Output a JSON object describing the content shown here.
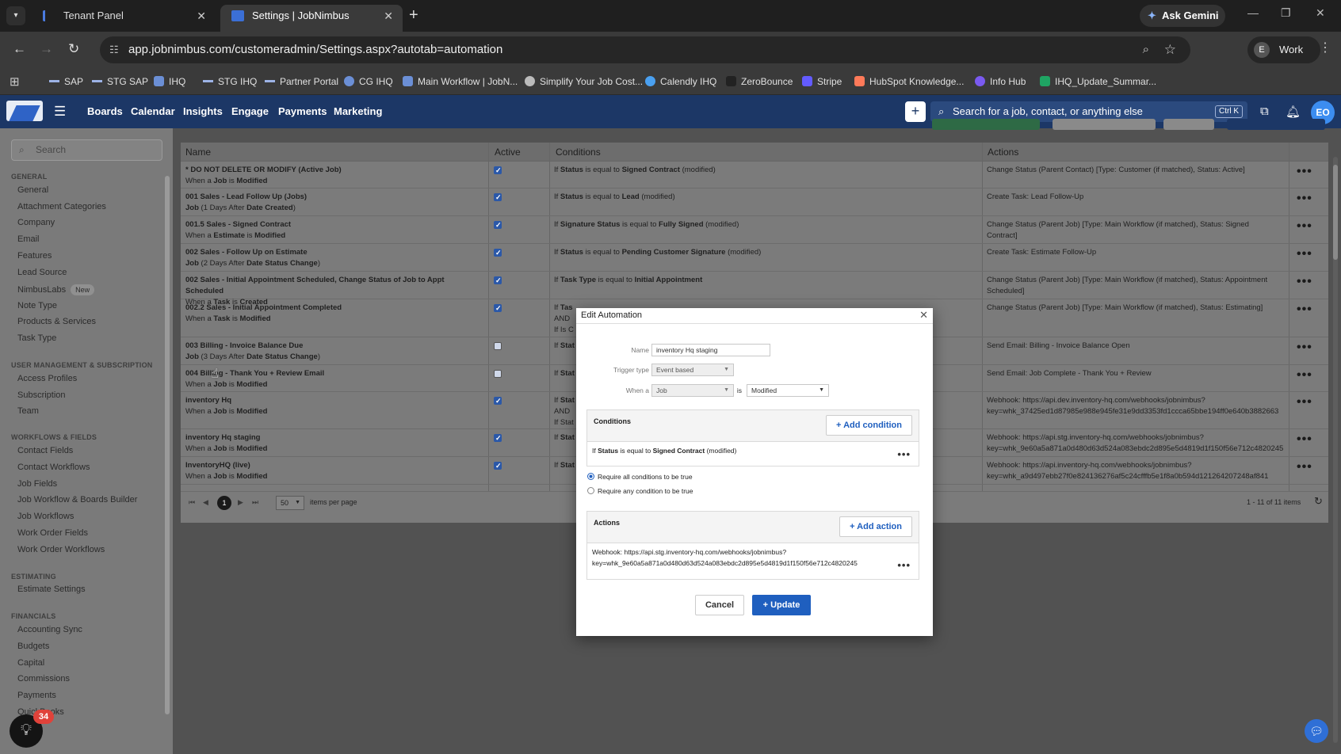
{
  "browser": {
    "tabs": [
      {
        "title": "Tenant Panel"
      },
      {
        "title": "Settings | JobNimbus"
      }
    ],
    "ask_gemini": "Ask Gemini",
    "url": "app.jobnimbus.com/customeradmin/Settings.aspx?autotab=automation",
    "profile_initial": "E",
    "profile_name": "Work",
    "bookmarks": [
      "SAP",
      "STG SAP",
      "IHQ",
      "STG IHQ",
      "Partner Portal",
      "CG IHQ",
      "Main Workflow | JobN...",
      "Simplify Your Job Cost...",
      "Calendly IHQ",
      "ZeroBounce",
      "Stripe",
      "HubSpot Knowledge...",
      "Info Hub",
      "IHQ_Update_Summar..."
    ]
  },
  "app_header": {
    "nav": [
      "Boards",
      "Calendar",
      "Insights",
      "Engage",
      "Payments",
      "Marketing"
    ],
    "search_placeholder": "Search for a job, contact, or anything else",
    "shortcut": "Ctrl K",
    "avatar": "EO"
  },
  "sidebar": {
    "search_placeholder": "Search",
    "general_head": "GENERAL",
    "general": [
      "General",
      "Attachment Categories",
      "Company",
      "Email",
      "Features",
      "Lead Source",
      "NimbusLabs",
      "Note Type",
      "Products & Services",
      "Task Type"
    ],
    "new_badge": "New",
    "user_head": "USER MANAGEMENT & SUBSCRIPTION",
    "user": [
      "Access Profiles",
      "Subscription",
      "Team"
    ],
    "workflows_head": "WORKFLOWS & FIELDS",
    "workflows": [
      "Contact Fields",
      "Contact Workflows",
      "Job Fields",
      "Job Workflow & Boards Builder",
      "Job Workflows",
      "Work Order Fields",
      "Work Order Workflows"
    ],
    "estimating_head": "ESTIMATING",
    "estimating": [
      "Estimate Settings"
    ],
    "financials_head": "FINANCIALS",
    "financials": [
      "Accounting Sync",
      "Budgets",
      "Capital",
      "Commissions",
      "Payments",
      "QuickBooks"
    ],
    "help_count": "34"
  },
  "table": {
    "headers": {
      "name": "Name",
      "active": "Active",
      "conditions": "Conditions",
      "actions": "Actions"
    },
    "rows": [
      {
        "name": "* DO NOT DELETE OR MODIFY (Active Job)",
        "sub_pre": "When a ",
        "sub_b1": "Job",
        "sub_mid": " is ",
        "sub_b2": "Modified",
        "active": true,
        "cond_pre": "If ",
        "cond_b1": "Status",
        "cond_mid": " is equal to ",
        "cond_b2": "Signed Contract",
        "cond_post": " (modified)",
        "cond_extra": "",
        "action": "Change Status (Parent Contact) [Type: Customer (if matched), Status: Active]"
      },
      {
        "name": "001 Sales - Lead Follow Up (Jobs)",
        "sub_pre": "",
        "sub_b1": "Job",
        "sub_mid": " (1 Days After ",
        "sub_b2": "Date Created",
        "sub_post": ")",
        "active": true,
        "cond_pre": "If ",
        "cond_b1": "Status",
        "cond_mid": " is equal to ",
        "cond_b2": "Lead",
        "cond_post": " (modified)",
        "cond_extra": "",
        "action": "Create Task: Lead Follow-Up"
      },
      {
        "name": "001.5 Sales - Signed Contract",
        "sub_pre": "When a ",
        "sub_b1": "Estimate",
        "sub_mid": " is ",
        "sub_b2": "Modified",
        "active": true,
        "cond_pre": "If ",
        "cond_b1": "Signature Status",
        "cond_mid": " is equal to ",
        "cond_b2": "Fully Signed",
        "cond_post": " (modified)",
        "cond_extra": "",
        "action": "Change Status (Parent Job) [Type: Main Workflow (if matched), Status: Signed Contract]"
      },
      {
        "name": "002 Sales - Follow Up on Estimate",
        "sub_pre": "",
        "sub_b1": "Job",
        "sub_mid": " (2 Days After ",
        "sub_b2": "Date Status Change",
        "sub_post": ")",
        "active": true,
        "cond_pre": "If ",
        "cond_b1": "Status",
        "cond_mid": " is equal to ",
        "cond_b2": "Pending Customer Signature",
        "cond_post": " (modified)",
        "cond_extra": "",
        "action": "Create Task: Estimate Follow-Up"
      },
      {
        "name": "002 Sales - Initial Appointment Scheduled, Change Status of Job to Appt Scheduled",
        "sub_pre": "When a ",
        "sub_b1": "Task",
        "sub_mid": " is ",
        "sub_b2": "Created",
        "active": true,
        "cond_pre": "If ",
        "cond_b1": "Task Type",
        "cond_mid": " is equal to ",
        "cond_b2": "Initial Appointment",
        "cond_post": "",
        "cond_extra": "",
        "action": "Change Status (Parent Job) [Type: Main Workflow (if matched), Status: Appointment Scheduled]"
      },
      {
        "name": "002.2 Sales - Initial Appointment Completed",
        "sub_pre": "When a ",
        "sub_b1": "Task",
        "sub_mid": " is ",
        "sub_b2": "Modified",
        "active": true,
        "cond_pre": "If ",
        "cond_b1": "Tas",
        "cond_mid": "",
        "cond_b2": "",
        "cond_post": "",
        "cond_extra": "AND",
        "cond_extra2": "If Is C",
        "action": "Change Status (Parent Job) [Type: Main Workflow (if matched), Status: Estimating]"
      },
      {
        "name": "003 Billing - Invoice Balance Due",
        "sub_pre": "",
        "sub_b1": "Job",
        "sub_mid": " (3 Days After ",
        "sub_b2": "Date Status Change",
        "sub_post": ")",
        "active": false,
        "cond_pre": "If ",
        "cond_b1": "Stat",
        "cond_mid": "",
        "cond_b2": "",
        "cond_post": "",
        "cond_extra": "",
        "action": "Send Email: Billing - Invoice Balance Open"
      },
      {
        "name": "004 Billing - Thank You + Review Email",
        "sub_pre": "When a ",
        "sub_b1": "Job",
        "sub_mid": " is ",
        "sub_b2": "Modified",
        "active": false,
        "cond_pre": "If ",
        "cond_b1": "Stat",
        "cond_mid": "",
        "cond_b2": "",
        "cond_post": "",
        "cond_extra": "",
        "action": "Send Email: Job Complete - Thank You + Review"
      },
      {
        "name": "inventory Hq",
        "sub_pre": "When a ",
        "sub_b1": "Job",
        "sub_mid": " is ",
        "sub_b2": "Modified",
        "active": true,
        "cond_pre": "If ",
        "cond_b1": "Stat",
        "cond_mid": "",
        "cond_b2": "",
        "cond_post": "",
        "cond_extra": "AND",
        "cond_extra2": "If Stat",
        "action": "Webhook: https://api.dev.inventory-hq.com/webhooks/jobnimbus?key=whk_37425ed1d87985e988e945fe31e9dd3353fd1ccca65bbe194ff0e640b3882663"
      },
      {
        "name": "inventory Hq staging",
        "sub_pre": "When a ",
        "sub_b1": "Job",
        "sub_mid": " is ",
        "sub_b2": "Modified",
        "active": true,
        "cond_pre": "If ",
        "cond_b1": "Stat",
        "cond_mid": "",
        "cond_b2": "",
        "cond_post": "",
        "cond_extra": "",
        "action": "Webhook: https://api.stg.inventory-hq.com/webhooks/jobnimbus?key=whk_9e60a5a871a0d480d63d524a083ebdc2d895e5d4819d1f150f56e712c4820245"
      },
      {
        "name": "InventoryHQ (live)",
        "sub_pre": "When a ",
        "sub_b1": "Job",
        "sub_mid": " is ",
        "sub_b2": "Modified",
        "active": true,
        "cond_pre": "If ",
        "cond_b1": "Stat",
        "cond_mid": "",
        "cond_b2": "",
        "cond_post": "",
        "cond_extra": "",
        "action": "Webhook: https://api.inventory-hq.com/webhooks/jobnimbus?key=whk_a9d497ebb27f0e824136276af5c24cfffb5e1f8a0b594d121264207248af841"
      }
    ],
    "pager": {
      "current_page": "1",
      "page_size": "50",
      "items_label": "items per page",
      "info": "1 - 11 of 11 items"
    }
  },
  "modal": {
    "title": "Edit Automation",
    "name_label": "Name",
    "name_value": "inventory Hq staging",
    "trigger_label": "Trigger type",
    "trigger_value": "Event based",
    "when_label": "When a",
    "when_value": "Job",
    "is_label": "is",
    "is_value": "Modified",
    "conditions_title": "Conditions",
    "add_condition": "+ Add condition",
    "condition": {
      "pre": "If ",
      "b1": "Status",
      "mid": " is equal to ",
      "b2": "Signed Contract",
      "post": " (modified)"
    },
    "require_all": "Require all conditions to be true",
    "require_any": "Require any condition to be true",
    "actions_title": "Actions",
    "add_action": "+ Add action",
    "action_line1": "Webhook: https://api.stg.inventory-hq.com/webhooks/jobnimbus?",
    "action_line2": "key=whk_9e60a5a871a0d480d63d524a083ebdc2d895e5d4819d1f150f56e712c4820245",
    "cancel": "Cancel",
    "update": "+ Update"
  },
  "colors": {
    "app_header": "#1c3766",
    "accent": "#1f5fbf",
    "overlay_bg": "#7b7b7b"
  }
}
